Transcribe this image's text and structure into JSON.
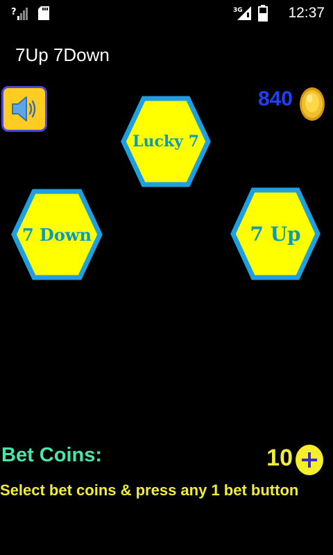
{
  "status_bar": {
    "time": "12:37",
    "network": "3G",
    "icons": [
      "signal-icon",
      "sd-card-icon",
      "mobile-data-icon",
      "battery-icon"
    ]
  },
  "app": {
    "title": "7Up 7Down"
  },
  "sound": {
    "icon": "speaker-icon"
  },
  "wallet": {
    "coins": "840",
    "icon": "gold-coin-icon"
  },
  "bets": {
    "lucky": "Lucky 7",
    "down": "7 Down",
    "up": "7 Up"
  },
  "bet_coins": {
    "label": "Bet Coins:",
    "value": "10",
    "increase_icon": "plus-icon"
  },
  "instruction": "Select bet coins & press any 1 bet button",
  "colors": {
    "background": "#000000",
    "hex_fill": "#ffff00",
    "hex_border": "#1ea0e0",
    "hex_text": "#0a9bb8",
    "coin_count": "#1f3fff",
    "bet_label": "#48e6a8",
    "highlight_yellow": "#f2ee38",
    "sound_bg": "#ffcc22"
  }
}
